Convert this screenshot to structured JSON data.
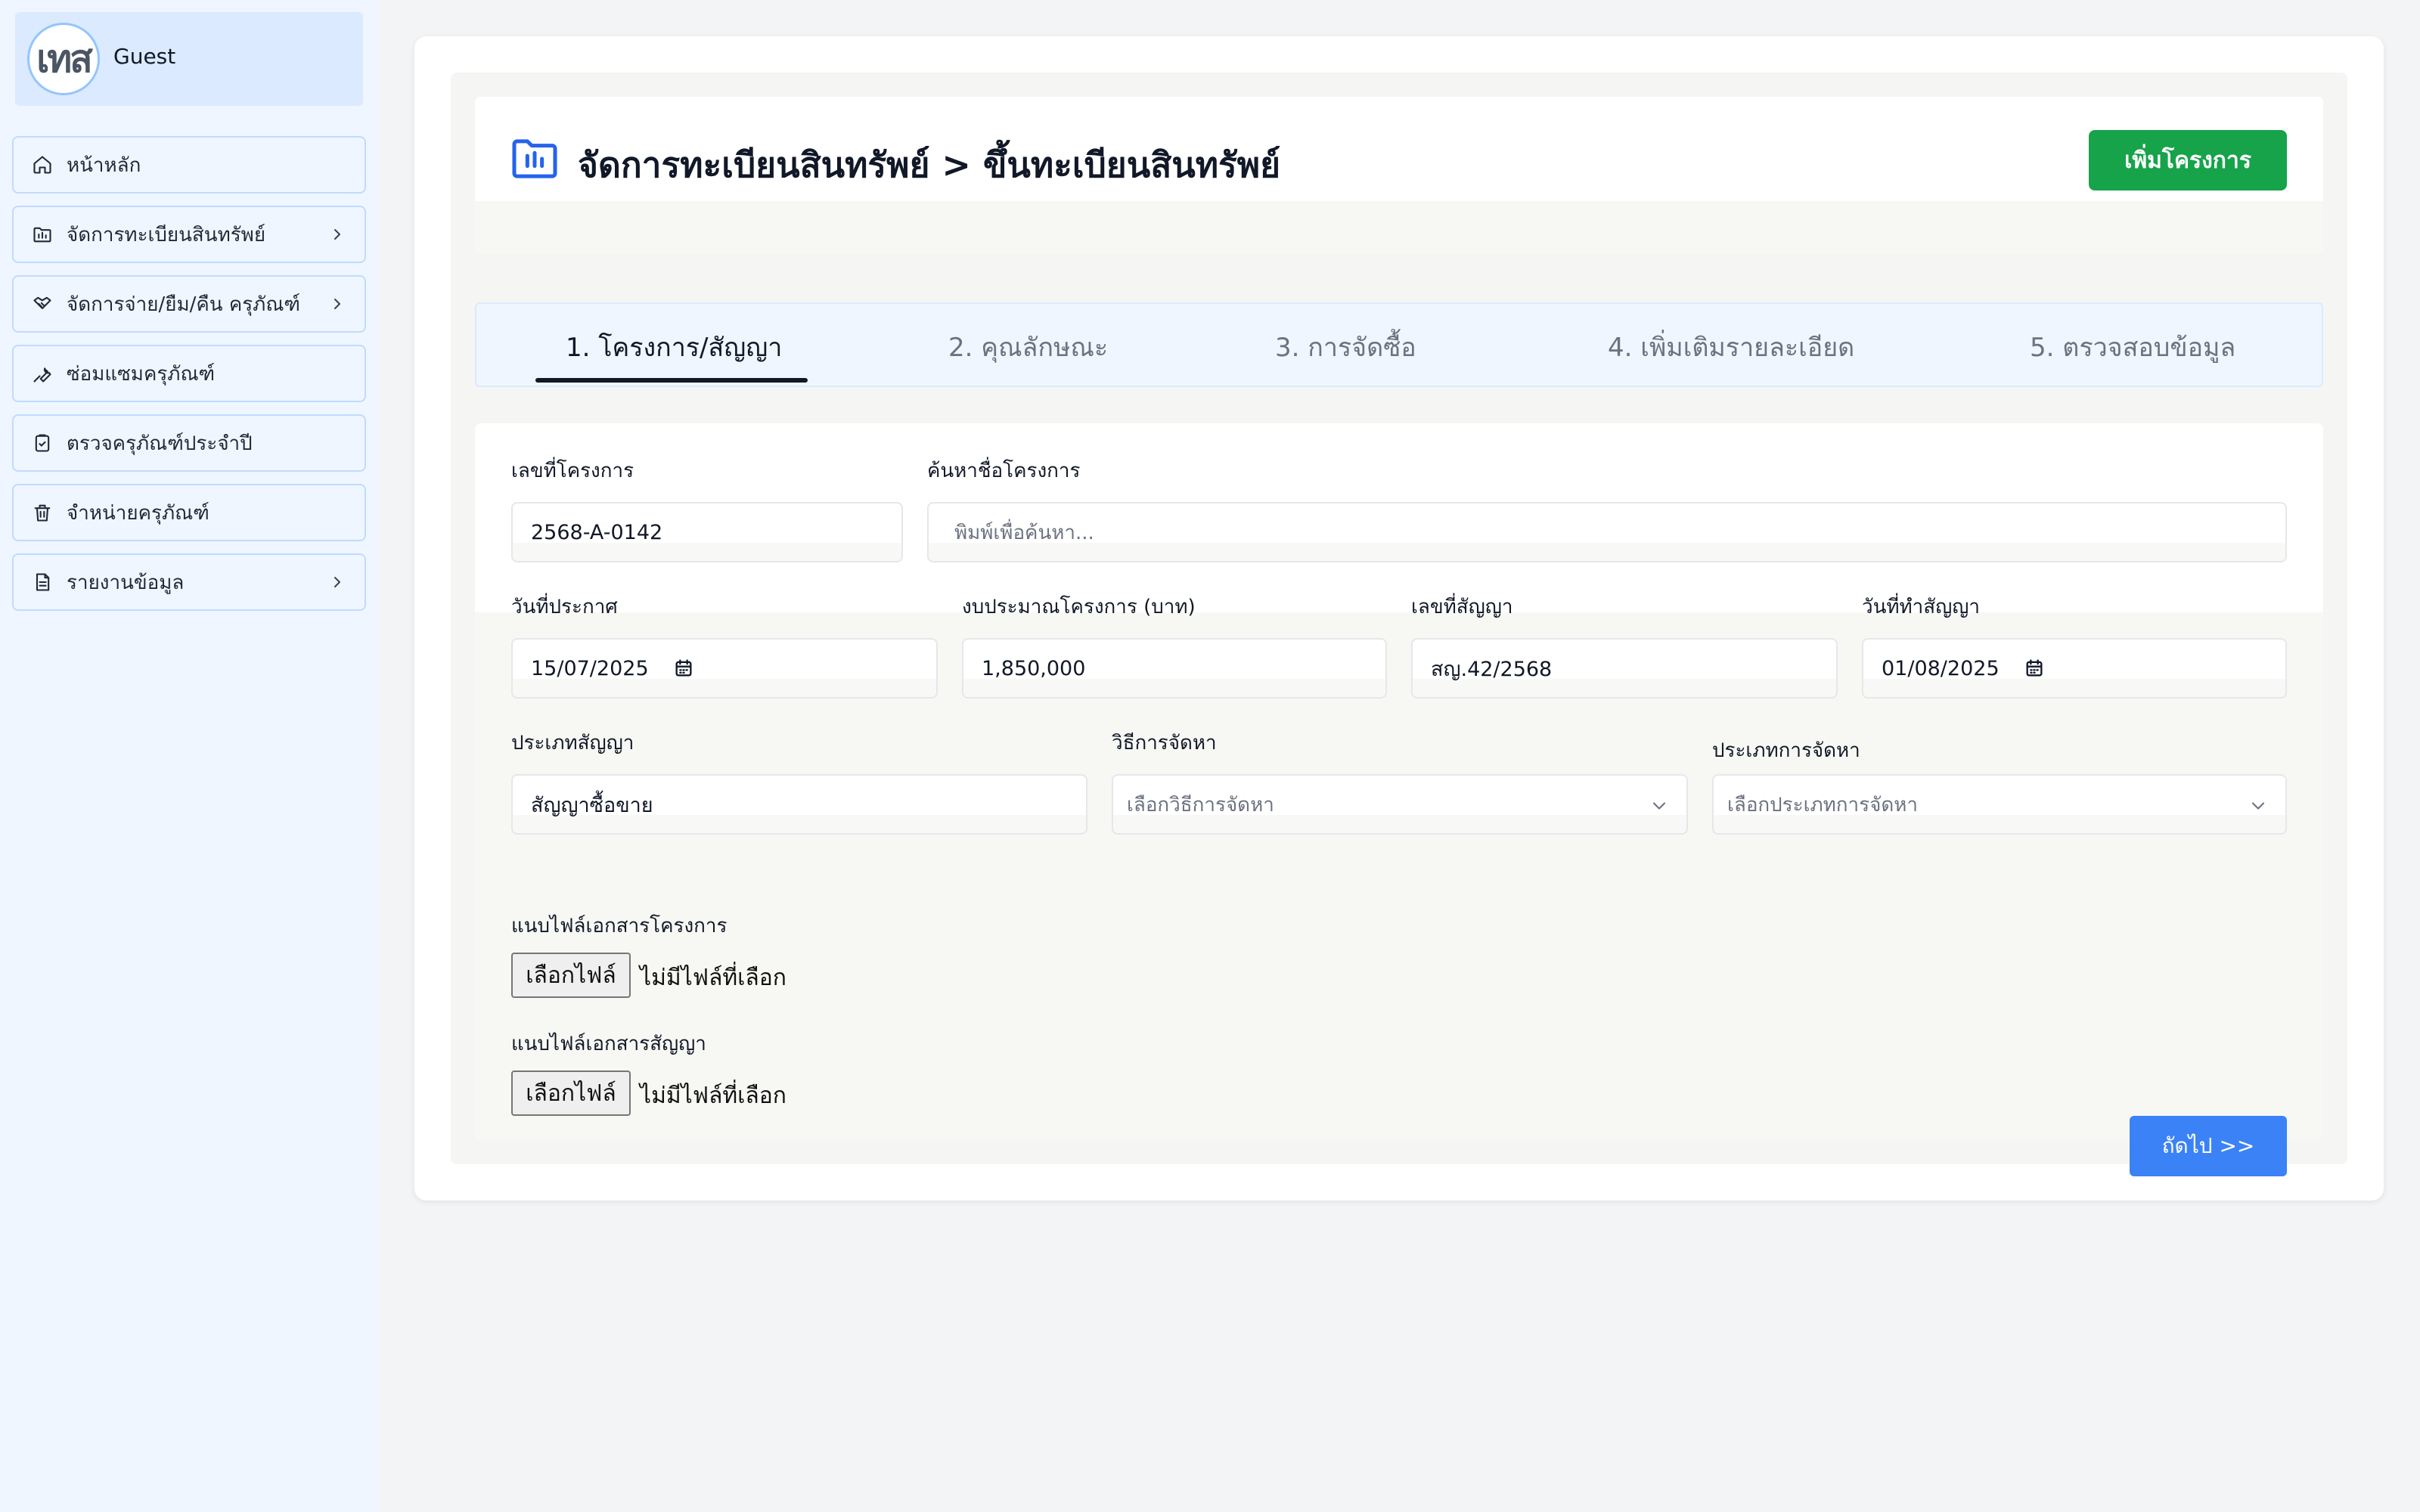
{
  "user": {
    "avatar_text": "เทส",
    "name": "Guest"
  },
  "sidebar": {
    "items": [
      {
        "label": "หน้าหลัก",
        "icon": "home-icon",
        "has_chevron": false
      },
      {
        "label": "จัดการทะเบียนสินทรัพย์",
        "icon": "folder-chart-icon",
        "has_chevron": true
      },
      {
        "label": "จัดการจ่าย/ยืม/คืน ครุภัณฑ์",
        "icon": "handshake-icon",
        "has_chevron": true
      },
      {
        "label": "ซ่อมแซมครุภัณฑ์",
        "icon": "wrench-icon",
        "has_chevron": false
      },
      {
        "label": "ตรวจครุภัณฑ์ประจำปี",
        "icon": "clipboard-check-icon",
        "has_chevron": false
      },
      {
        "label": "จำหน่ายครุภัณฑ์",
        "icon": "trash-icon",
        "has_chevron": false
      },
      {
        "label": "รายงานข้อมูล",
        "icon": "document-icon",
        "has_chevron": true
      }
    ]
  },
  "header": {
    "title": "จัดการทะเบียนสินทรัพย์ > ขึ้นทะเบียนสินทรัพย์",
    "add_button": "เพิ่มโครงการ"
  },
  "tabs": [
    {
      "label": "1. โครงการ/สัญญา",
      "active": true
    },
    {
      "label": "2. คุณลักษณะ",
      "active": false
    },
    {
      "label": "3. การจัดซื้อ",
      "active": false
    },
    {
      "label": "4. เพิ่มเติมรายละเอียด",
      "active": false
    },
    {
      "label": "5. ตรวจสอบข้อมูล",
      "active": false
    }
  ],
  "form": {
    "project_no": {
      "label": "เลขที่โครงการ",
      "value": "2568-A-0142"
    },
    "search": {
      "label": "ค้นหาชื่อโครงการ",
      "placeholder": "พิมพ์เพื่อค้นหา..."
    },
    "announce_date": {
      "label": "วันที่ประกาศ",
      "value": "15/07/2025"
    },
    "budget": {
      "label": "งบประมาณโครงการ (บาท)",
      "value": "1,850,000"
    },
    "contract_no": {
      "label": "เลขที่สัญญา",
      "value": "สญ.42/2568"
    },
    "contract_date": {
      "label": "วันที่ทำสัญญา",
      "value": "01/08/2025"
    },
    "contract_type": {
      "label": "ประเภทสัญญา",
      "value": "สัญญาซื้อขาย"
    },
    "procurement_method": {
      "label": "วิธีการจัดหา",
      "placeholder": "เลือกวิธีการจัดหา"
    },
    "procurement_type": {
      "label": "ประเภทการจัดหา",
      "placeholder": "เลือกประเภทการจัดหา"
    },
    "project_file": {
      "label": "แนบไฟล์เอกสารโครงการ",
      "button": "เลือกไฟล์",
      "status": "ไม่มีไฟล์ที่เลือก"
    },
    "contract_file": {
      "label": "แนบไฟล์เอกสารสัญญา",
      "button": "เลือกไฟล์",
      "status": "ไม่มีไฟล์ที่เลือก"
    },
    "next_button": "ถัดไป >>"
  },
  "colors": {
    "accent_green": "#16a34a",
    "accent_blue": "#3b82f6",
    "sidebar_bg": "#eff6ff",
    "icon_blue": "#2563eb"
  }
}
